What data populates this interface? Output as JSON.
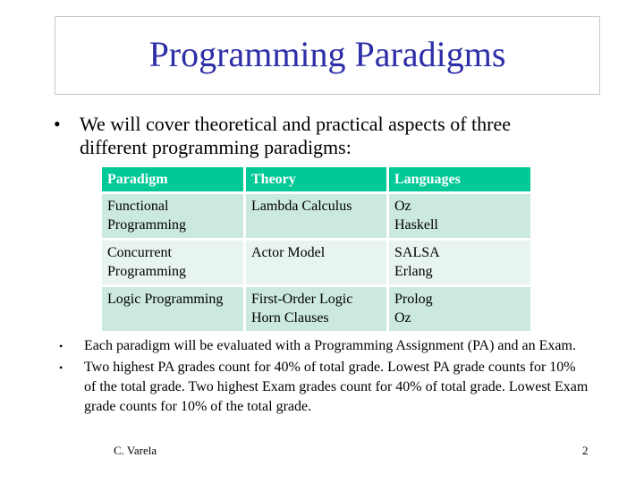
{
  "slide": {
    "title": "Programming Paradigms",
    "title_color": "#2e2ea8",
    "intro_bullet": "We will cover theoretical and practical aspects of three different programming paradigms:",
    "bullet_glyph": "•",
    "table": {
      "header_color": "#00c896",
      "row_colors": [
        "#cce9de",
        "#e7f4ef"
      ],
      "headers": [
        "Paradigm",
        "Theory",
        "Languages"
      ],
      "rows": [
        {
          "paradigm": [
            "Functional",
            "Programming"
          ],
          "theory": [
            "Lambda Calculus"
          ],
          "languages": [
            "Oz",
            "Haskell"
          ]
        },
        {
          "paradigm": [
            "Concurrent",
            "Programming"
          ],
          "theory": [
            "Actor Model"
          ],
          "languages": [
            "SALSA",
            "Erlang"
          ]
        },
        {
          "paradigm": [
            "Logic Programming"
          ],
          "theory": [
            "First-Order Logic",
            "Horn Clauses"
          ],
          "languages": [
            "Prolog",
            "Oz"
          ]
        }
      ]
    },
    "sub_bullets": [
      "Each paradigm will be evaluated with a Programming Assignment (PA) and an Exam.",
      "Two highest PA grades count for 40% of total grade. Lowest PA grade counts for 10% of the total grade. Two highest Exam grades count for 40% of total grade. Lowest Exam grade counts for 10% of the total grade."
    ],
    "footer": {
      "author": "C. Varela",
      "page_number": "2"
    }
  }
}
